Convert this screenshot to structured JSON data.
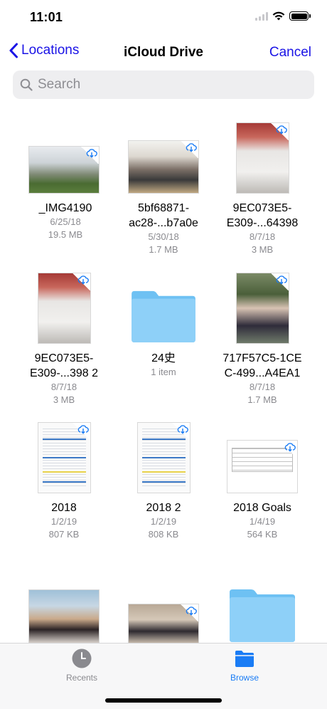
{
  "status_bar": {
    "time": "11:01"
  },
  "nav": {
    "back_label": "Locations",
    "title": "iCloud Drive",
    "cancel_label": "Cancel"
  },
  "search": {
    "placeholder": "Search"
  },
  "colors": {
    "accent": "#1a13e6",
    "tab_active": "#1a7cf5",
    "tab_inactive": "#8a8a8f",
    "folder": "#7fc6f5"
  },
  "items": [
    {
      "name_line1": "_IMG4190",
      "name_line2": "",
      "date": "6/25/18",
      "size": "19.5 MB",
      "kind": "photo",
      "icon": "cloud-download-icon"
    },
    {
      "name_line1": "5bf68871-",
      "name_line2": "ac28-...b7a0e",
      "date": "5/30/18",
      "size": "1.7 MB",
      "kind": "photo",
      "icon": "cloud-download-icon"
    },
    {
      "name_line1": "9EC073E5-",
      "name_line2": "E309-...64398",
      "date": "8/7/18",
      "size": "3 MB",
      "kind": "photo",
      "icon": "cloud-download-icon"
    },
    {
      "name_line1": "9EC073E5-",
      "name_line2": "E309-...398 2",
      "date": "8/7/18",
      "size": "3 MB",
      "kind": "photo",
      "icon": "cloud-download-icon"
    },
    {
      "name_line1": "24史",
      "name_line2": "",
      "date": "1 item",
      "size": "",
      "kind": "folder",
      "icon": "folder-icon"
    },
    {
      "name_line1": "717F57C5-1CE",
      "name_line2": "C-499...A4EA1",
      "date": "8/7/18",
      "size": "1.7 MB",
      "kind": "photo",
      "icon": "cloud-download-icon"
    },
    {
      "name_line1": "2018",
      "name_line2": "",
      "date": "1/2/19",
      "size": "807 KB",
      "kind": "spreadsheet",
      "icon": "cloud-download-icon"
    },
    {
      "name_line1": "2018 2",
      "name_line2": "",
      "date": "1/2/19",
      "size": "808 KB",
      "kind": "spreadsheet",
      "icon": "cloud-download-icon"
    },
    {
      "name_line1": "2018 Goals",
      "name_line2": "",
      "date": "1/4/19",
      "size": "564 KB",
      "kind": "document",
      "icon": "cloud-download-icon"
    }
  ],
  "tabs": {
    "recents": "Recents",
    "browse": "Browse"
  }
}
